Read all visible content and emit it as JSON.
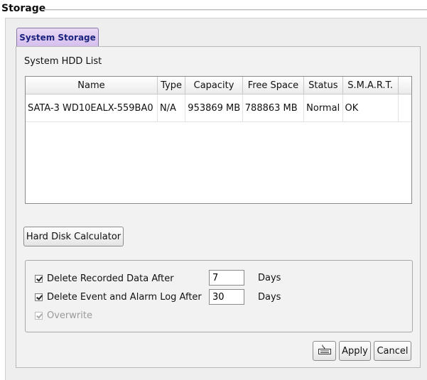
{
  "window": {
    "title": "Storage"
  },
  "tabs": [
    {
      "label": "System Storage",
      "active": true
    }
  ],
  "hdd_list": {
    "label": "System HDD List",
    "columns": [
      "Name",
      "Type",
      "Capacity",
      "Free Space",
      "Status",
      "S.M.A.R.T."
    ],
    "rows": [
      [
        "SATA-3 WD10EALX-559BA0",
        "N/A",
        "953869 MB",
        "788863 MB",
        "Normal",
        "OK"
      ]
    ]
  },
  "buttons": {
    "calculator": "Hard Disk Calculator",
    "apply": "Apply",
    "cancel": "Cancel",
    "keyboard_icon": "keyboard-icon"
  },
  "options": {
    "delete_recorded": {
      "label": "Delete Recorded Data After",
      "checked": true,
      "value": "7",
      "unit": "Days"
    },
    "delete_event": {
      "label": "Delete Event and Alarm Log After",
      "checked": true,
      "value": "30",
      "unit": "Days"
    },
    "overwrite": {
      "label": "Overwrite",
      "checked": true,
      "disabled": true
    }
  },
  "colors": {
    "tab_bg": "#d6bfee",
    "tab_text": "#1a237e",
    "panel_bg": "#f2f2f2"
  }
}
